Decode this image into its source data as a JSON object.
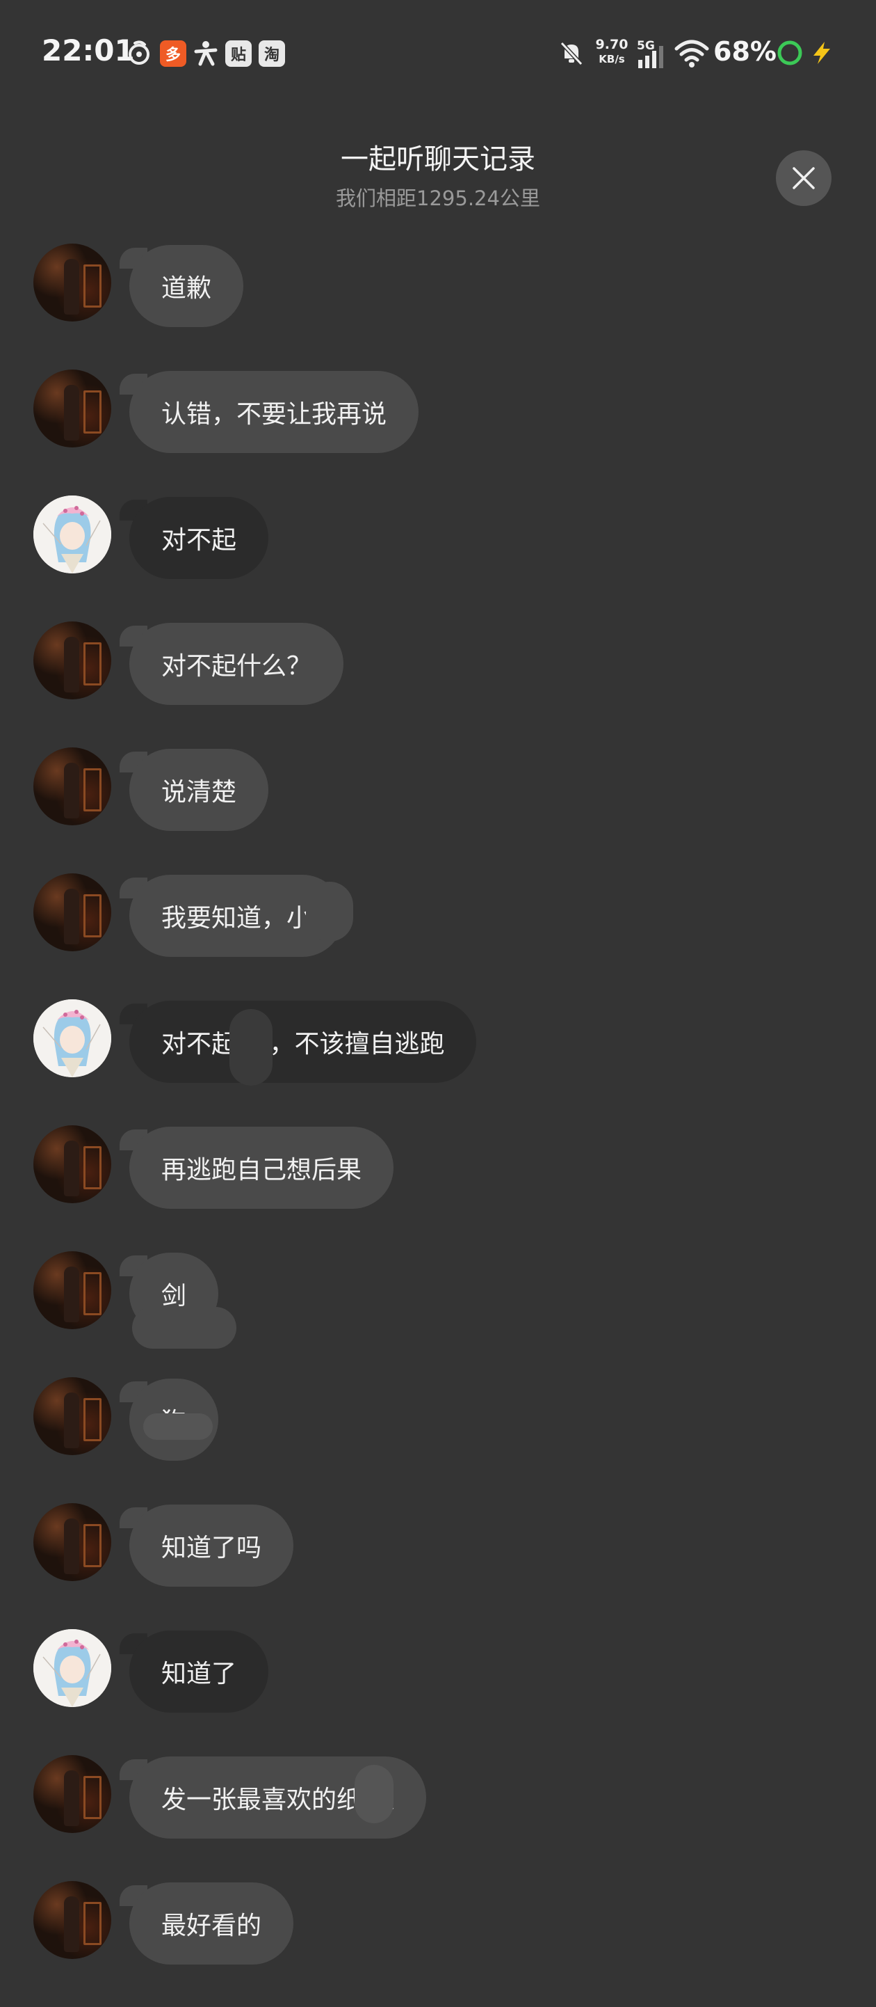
{
  "status_bar": {
    "time": "22:01",
    "net_speed_value": "9.70",
    "net_speed_unit": "KB/s",
    "network_type": "5G",
    "battery": "68%",
    "apps": [
      "pinduoduo",
      "tieba",
      "taobao"
    ],
    "app_labels": {
      "tieba": "贴",
      "taobao": "淘",
      "orange": "多"
    },
    "icons": [
      "netease-music-icon",
      "app-orange-icon",
      "person-app-icon",
      "tieba-icon",
      "taobao-icon",
      "mute-bell-icon",
      "signal-icon",
      "wifi-icon",
      "ring-icon",
      "charging-icon"
    ]
  },
  "header": {
    "title": "一起听聊天记录",
    "subtitle": "我们相距1295.24公里"
  },
  "colors": {
    "background": "#343434",
    "bubble_them": "#4a4a4a",
    "bubble_me": "#2b2b2b",
    "ring_green": "#3cc957",
    "charge_yellow": "#f5c518"
  },
  "messages": [
    {
      "sender": "them",
      "text": "道歉"
    },
    {
      "sender": "them",
      "text": "认错，不要让我再说"
    },
    {
      "sender": "me",
      "text": "对不起"
    },
    {
      "sender": "them",
      "text": "对不起什么？"
    },
    {
      "sender": "them",
      "text": "说清楚"
    },
    {
      "sender": "them",
      "text": "我要知道，小"
    },
    {
      "sender": "me",
      "text": "对不起  人，不该擅自逃跑"
    },
    {
      "sender": "them",
      "text": "再逃跑自己想后果"
    },
    {
      "sender": "them",
      "text": "剑"
    },
    {
      "sender": "them",
      "text": "狗"
    },
    {
      "sender": "them",
      "text": "知道了吗"
    },
    {
      "sender": "me",
      "text": "知道了"
    },
    {
      "sender": "them",
      "text": "发一张最喜欢的纸  人"
    },
    {
      "sender": "them",
      "text": "最好看的"
    }
  ]
}
